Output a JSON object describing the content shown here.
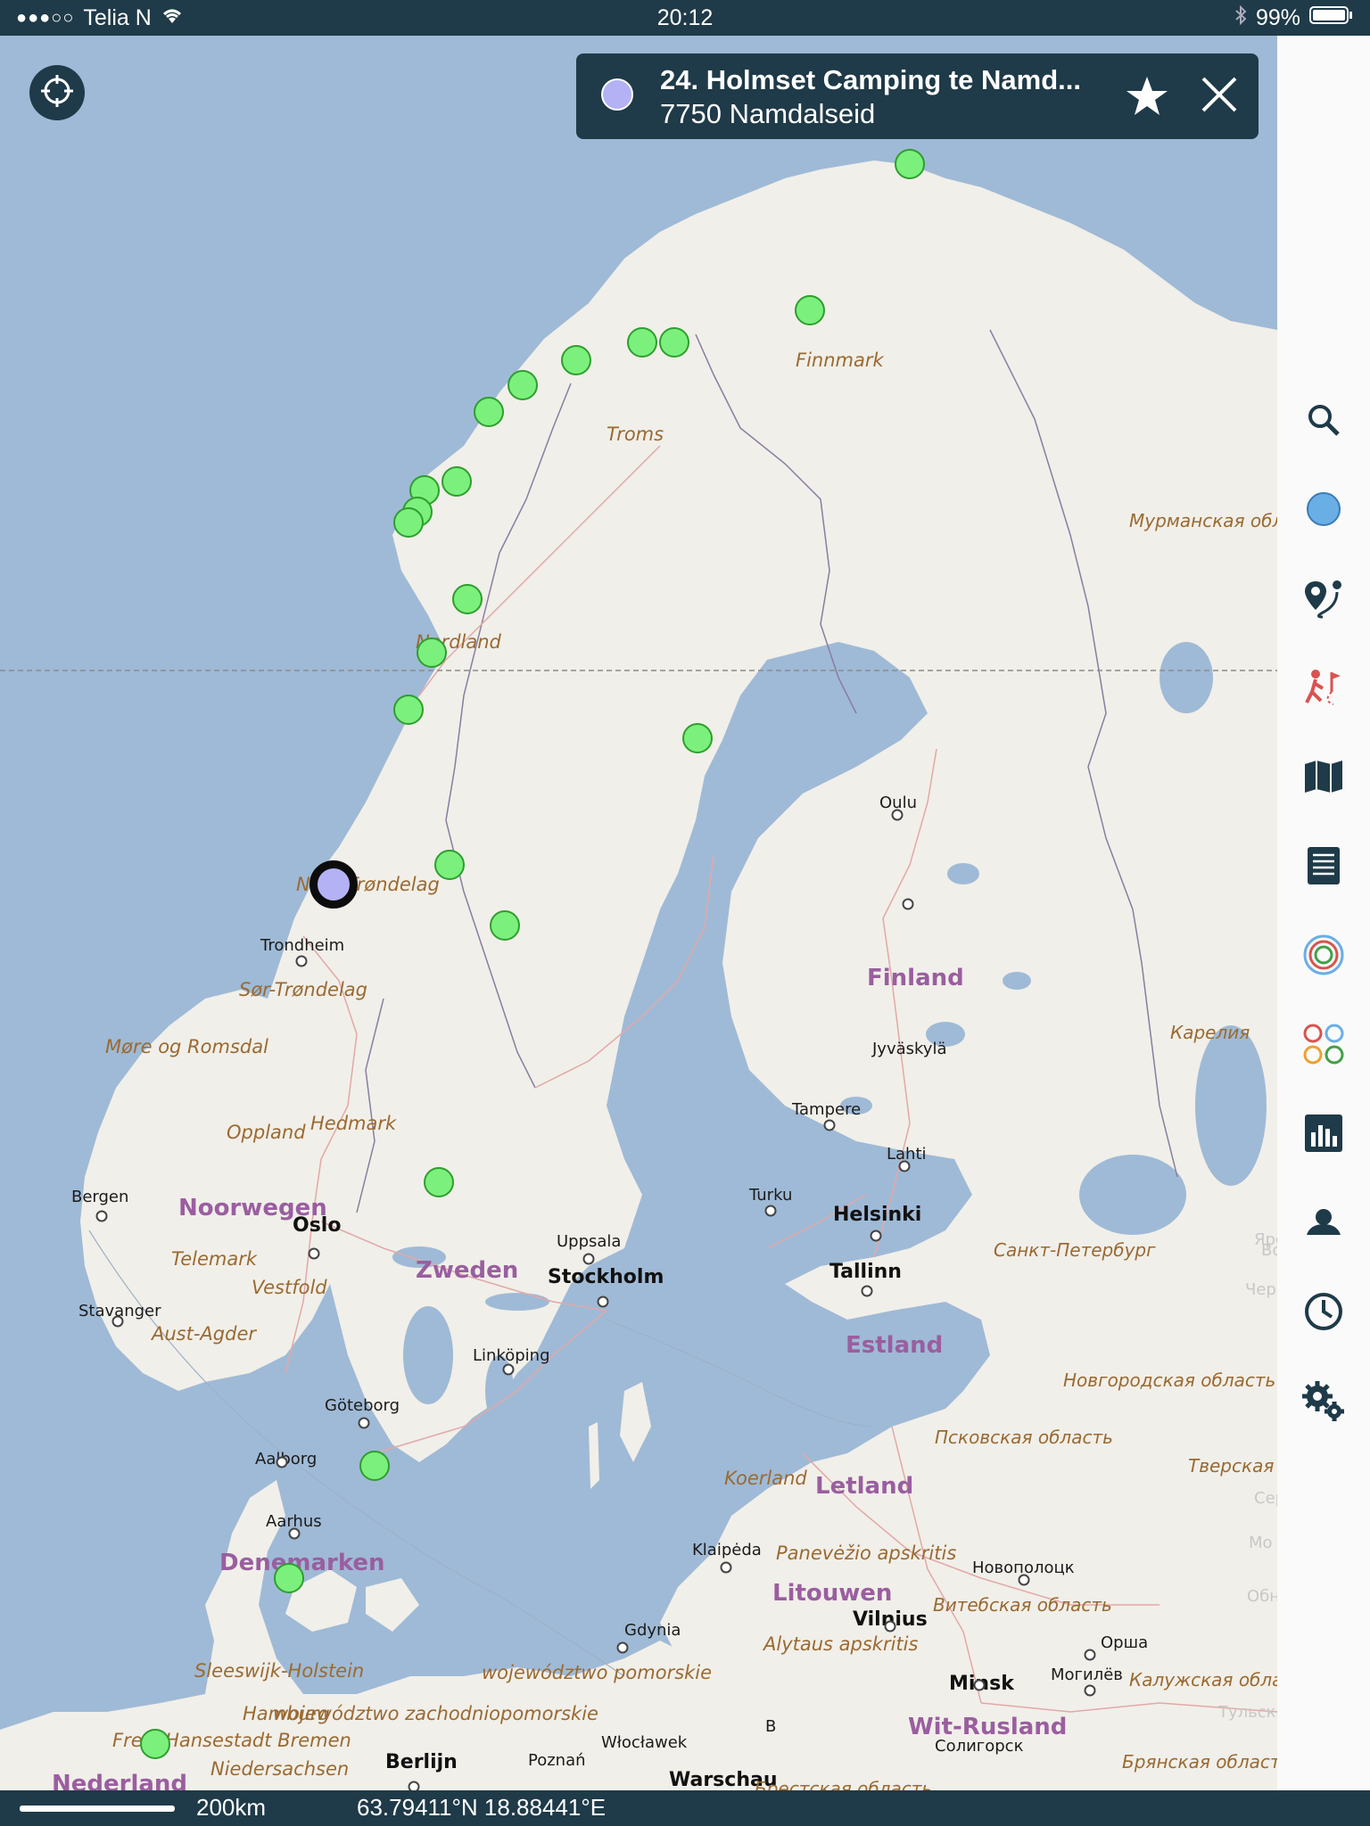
{
  "status_bar": {
    "signal_dots": "●●●○○",
    "carrier": "Telia N",
    "time": "20:12",
    "battery": "99%"
  },
  "popup": {
    "title": "24. Holmset Camping te Namd...",
    "subtitle": "7750 Namdalseid"
  },
  "map": {
    "labels": [
      {
        "text": "Finnmark",
        "kind": "region"
      },
      {
        "text": "Troms",
        "kind": "region"
      },
      {
        "text": "Nordland",
        "kind": "region"
      },
      {
        "text": "Nord-Trøndelag",
        "kind": "region"
      },
      {
        "text": "Trondheim",
        "kind": "city"
      },
      {
        "text": "Sør-Trøndelag",
        "kind": "region"
      },
      {
        "text": "Møre og Romsdal",
        "kind": "region"
      },
      {
        "text": "Oppland",
        "kind": "region"
      },
      {
        "text": "Hedmark",
        "kind": "region"
      },
      {
        "text": "Bergen",
        "kind": "city"
      },
      {
        "text": "Noorwegen",
        "kind": "country"
      },
      {
        "text": "Oslo",
        "kind": "bigcity"
      },
      {
        "text": "Telemark",
        "kind": "region"
      },
      {
        "text": "Vestfold",
        "kind": "region"
      },
      {
        "text": "Stavanger",
        "kind": "city"
      },
      {
        "text": "Aust-Agder",
        "kind": "region"
      },
      {
        "text": "Zweden",
        "kind": "country"
      },
      {
        "text": "Uppsala",
        "kind": "city"
      },
      {
        "text": "Stockholm",
        "kind": "bigcity"
      },
      {
        "text": "Linköping",
        "kind": "city"
      },
      {
        "text": "Göteborg",
        "kind": "city"
      },
      {
        "text": "Aalborg",
        "kind": "city"
      },
      {
        "text": "Aarhus",
        "kind": "city"
      },
      {
        "text": "Denemarken",
        "kind": "country"
      },
      {
        "text": "Sleeswijk-Holstein",
        "kind": "region"
      },
      {
        "text": "Hamburg",
        "kind": "region"
      },
      {
        "text": "Freie Hansestadt Bremen",
        "kind": "region"
      },
      {
        "text": "Niedersachsen",
        "kind": "region"
      },
      {
        "text": "Nederland",
        "kind": "country"
      },
      {
        "text": "Berlijn",
        "kind": "bigcity"
      },
      {
        "text": "województwo pomorskie",
        "kind": "region"
      },
      {
        "text": "województwo zachodniopomorskie",
        "kind": "region"
      },
      {
        "text": "Gdynia",
        "kind": "city"
      },
      {
        "text": "Poznań",
        "kind": "city"
      },
      {
        "text": "Włocławek",
        "kind": "city"
      },
      {
        "text": "Warschau",
        "kind": "bigcity"
      },
      {
        "text": "Oulu",
        "kind": "city"
      },
      {
        "text": "Finland",
        "kind": "country"
      },
      {
        "text": "Jyväskylä",
        "kind": "city"
      },
      {
        "text": "Tampere",
        "kind": "city"
      },
      {
        "text": "Lahti",
        "kind": "city"
      },
      {
        "text": "Turku",
        "kind": "city"
      },
      {
        "text": "Helsinki",
        "kind": "bigcity"
      },
      {
        "text": "Tallinn",
        "kind": "bigcity"
      },
      {
        "text": "Estland",
        "kind": "country"
      },
      {
        "text": "Koerland",
        "kind": "region"
      },
      {
        "text": "Letland",
        "kind": "country"
      },
      {
        "text": "Klaipėda",
        "kind": "city"
      },
      {
        "text": "Panevėžio apskritis",
        "kind": "region"
      },
      {
        "text": "Litouwen",
        "kind": "country"
      },
      {
        "text": "Vilnius",
        "kind": "bigcity"
      },
      {
        "text": "Alytaus apskritis",
        "kind": "region"
      },
      {
        "text": "Minsk",
        "kind": "bigcity"
      },
      {
        "text": "Wit-Rusland",
        "kind": "country"
      },
      {
        "text": "Мурманская область",
        "kind": "rus"
      },
      {
        "text": "Карелия",
        "kind": "rus"
      },
      {
        "text": "Санкт-Петербург",
        "kind": "rus"
      },
      {
        "text": "Новгородская область",
        "kind": "rus"
      },
      {
        "text": "Псковская область",
        "kind": "rus"
      },
      {
        "text": "Тверская область",
        "kind": "rus"
      },
      {
        "text": "Новополоцк",
        "kind": "city"
      },
      {
        "text": "Витебская область",
        "kind": "rus"
      },
      {
        "text": "Орша",
        "kind": "city"
      },
      {
        "text": "Могилёв",
        "kind": "city"
      },
      {
        "text": "Калужская область",
        "kind": "rus"
      },
      {
        "text": "Тульская",
        "kind": "ghost"
      },
      {
        "text": "Брянская область",
        "kind": "rus"
      },
      {
        "text": "Солигорск",
        "kind": "city"
      },
      {
        "text": "Брестская область",
        "kind": "rus"
      },
      {
        "text": "B",
        "kind": "city"
      },
      {
        "text": "Черн",
        "kind": "ghost"
      },
      {
        "text": "Серп",
        "kind": "ghost"
      },
      {
        "text": "Мо",
        "kind": "ghost"
      },
      {
        "text": "Обнинск",
        "kind": "ghost"
      },
      {
        "text": "Вс",
        "kind": "ghost"
      },
      {
        "text": "Яро",
        "kind": "ghost"
      }
    ]
  },
  "sidebar": {
    "tools": [
      {
        "name": "search-icon"
      },
      {
        "name": "blue-circle-icon"
      },
      {
        "name": "route-pin-icon"
      },
      {
        "name": "hiker-icon"
      },
      {
        "name": "map-icon"
      },
      {
        "name": "list-icon"
      },
      {
        "name": "rings-icon"
      },
      {
        "name": "colored-circles-icon"
      },
      {
        "name": "chart-icon"
      },
      {
        "name": "user-icon"
      },
      {
        "name": "clock-icon"
      },
      {
        "name": "gear-icon"
      }
    ]
  },
  "bottom_bar": {
    "scale": "200km",
    "coordinates": "63.79411°N 18.88441°E"
  },
  "colors": {
    "bar": "#1f3a48",
    "sea": "#9fbad6",
    "land": "#f1efe9",
    "pin": "#7cf07c",
    "selected_pin": "#b4b2f5"
  }
}
